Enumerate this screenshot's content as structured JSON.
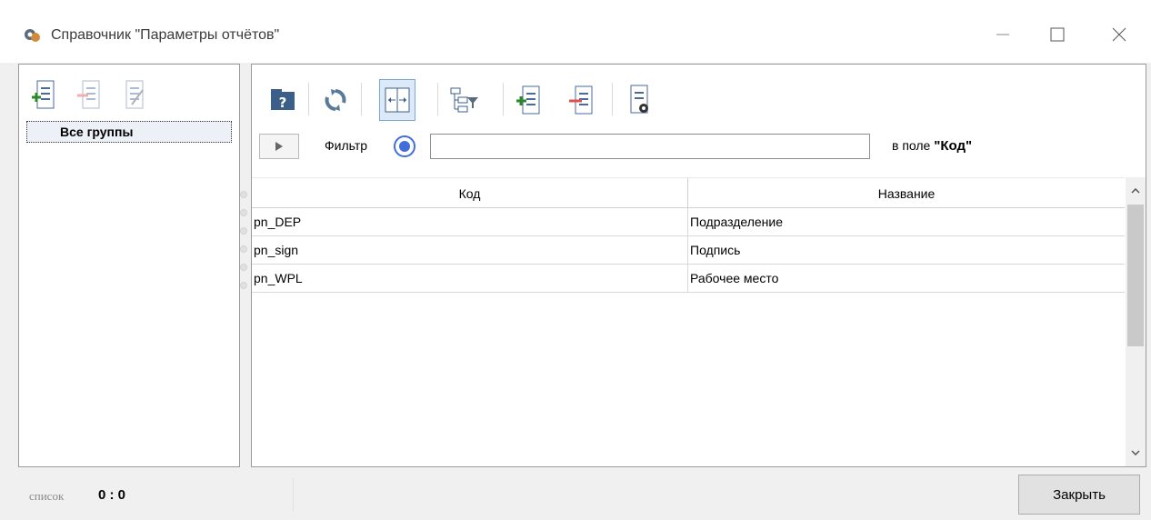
{
  "window": {
    "title": "Справочник \"Параметры отчётов\"",
    "icon": "app-icon",
    "controls": [
      "minimize-icon",
      "maximize-icon",
      "close-icon"
    ]
  },
  "left_panel": {
    "toolbar": [
      "add-group-icon",
      "delete-group-icon",
      "edit-group-icon"
    ],
    "groups": [
      "Все группы"
    ]
  },
  "toolbar": {
    "buttons": [
      "help-icon",
      "refresh-icon",
      "fit-columns-icon",
      "tree-filter-icon",
      "add-record-icon",
      "delete-record-icon",
      "settings-icon"
    ]
  },
  "filter": {
    "label": "Фильтр",
    "value": "",
    "field_prefix": "в поле",
    "field_name": "\"Код\""
  },
  "table": {
    "columns": [
      "Код",
      "Название"
    ],
    "rows": [
      [
        "pn_DEP",
        "Подразделение"
      ],
      [
        "pn_sign",
        "Подпись"
      ],
      [
        "pn_WPL",
        "Рабочее место"
      ]
    ]
  },
  "status": {
    "mode": "список",
    "count": "0 : 0"
  },
  "buttons": {
    "close": "Закрыть"
  },
  "colors": {
    "accent": "#3f6fd8",
    "remove": "#e05050",
    "add": "#2a8a2a"
  }
}
